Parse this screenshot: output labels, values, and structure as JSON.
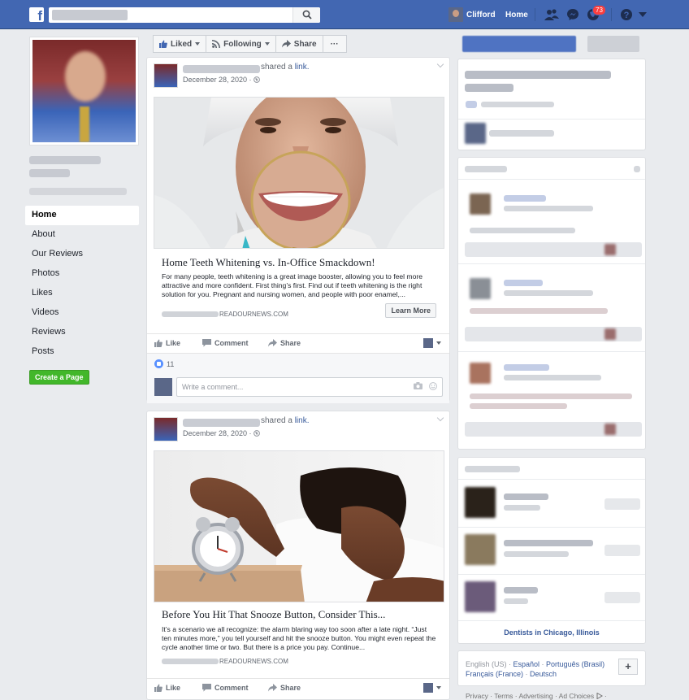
{
  "topbar": {
    "logo": "f",
    "user_name": "Clifford",
    "home": "Home",
    "notifications_count": "73"
  },
  "left_nav": {
    "items": [
      {
        "label": "Home",
        "active": true
      },
      {
        "label": "About",
        "active": false
      },
      {
        "label": "Our Reviews",
        "active": false
      },
      {
        "label": "Photos",
        "active": false
      },
      {
        "label": "Likes",
        "active": false
      },
      {
        "label": "Videos",
        "active": false
      },
      {
        "label": "Reviews",
        "active": false
      },
      {
        "label": "Posts",
        "active": false
      }
    ],
    "create_page": "Create a Page"
  },
  "action_bar": {
    "liked": "Liked",
    "following": "Following",
    "share": "Share",
    "more": "···"
  },
  "posts": [
    {
      "shared": "shared a",
      "link_word": "link.",
      "date": "December 28, 2020 ·",
      "title": "Home Teeth Whitening vs. In-Office Smackdown!",
      "description": "For many people, teeth whitening is a great image booster, allowing you to feel more attractive and more confident. First thing’s first. Find out if teeth whitening is the right solution for you. Pregnant and nursing women, and people with poor enamel,...",
      "domain": "READOURNEWS.COM",
      "cta": "Learn More",
      "actions": {
        "like": "Like",
        "comment": "Comment",
        "share": "Share"
      },
      "likes": "11",
      "comment_placeholder": "Write a comment..."
    },
    {
      "shared": "shared a",
      "link_word": "link.",
      "date": "December 28, 2020 ·",
      "title": "Before You Hit That Snooze Button, Consider This...",
      "description": "It’s a scenario we all recognize: the alarm blaring way too soon after a late night. “Just ten minutes more,” you tell yourself and hit the snooze button. You might even repeat the cycle another time or two. But there is a price you pay. Continue...",
      "domain": "READOURNEWS.COM",
      "actions": {
        "like": "Like",
        "comment": "Comment",
        "share": "Share"
      }
    }
  ],
  "right_col": {
    "dentists_link": "Dentists in Chicago, Illinois",
    "languages": {
      "current": "English (US)",
      "options": [
        "Español",
        "Português (Brasil)",
        "Français (France)",
        "Deutsch"
      ]
    },
    "footer": [
      "Privacy",
      "Terms",
      "Advertising",
      "Ad Choices"
    ]
  },
  "colors": {
    "brand_blue": "#4267b2",
    "link_blue": "#365899",
    "create_green": "#42b72a",
    "badge_red": "#fa3e3e"
  }
}
